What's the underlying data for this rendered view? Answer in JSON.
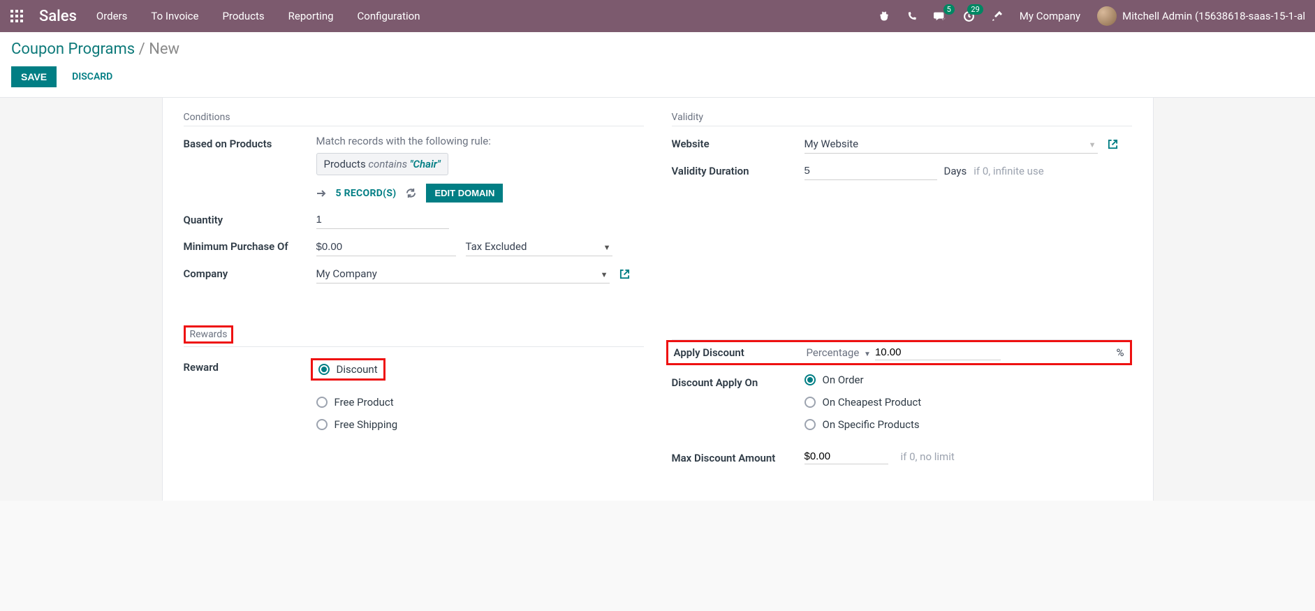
{
  "navbar": {
    "brand": "Sales",
    "menu": [
      "Orders",
      "To Invoice",
      "Products",
      "Reporting",
      "Configuration"
    ],
    "msg_badge": "5",
    "activity_badge": "29",
    "company": "My Company",
    "user": "Mitchell Admin (15638618-saas-15-1-al"
  },
  "breadcrumb": {
    "parent": "Coupon Programs",
    "current": "New"
  },
  "actions": {
    "save": "SAVE",
    "discard": "DISCARD"
  },
  "conditions": {
    "title": "Conditions",
    "based_on_products_label": "Based on Products",
    "domain_desc": "Match records with the following rule:",
    "domain_chip_field": "Products",
    "domain_chip_op": "contains",
    "domain_chip_val": "\"Chair\"",
    "records_link": "5 RECORD(S)",
    "edit_domain": "EDIT DOMAIN",
    "quantity_label": "Quantity",
    "quantity_value": "1",
    "min_purchase_label": "Minimum Purchase Of",
    "min_purchase_value": "$0.00",
    "tax_option": "Tax Excluded",
    "company_label": "Company",
    "company_value": "My Company"
  },
  "validity": {
    "title": "Validity",
    "website_label": "Website",
    "website_value": "My Website",
    "duration_label": "Validity Duration",
    "duration_value": "5",
    "days": "Days",
    "hint": "if 0, infinite use"
  },
  "rewards": {
    "title": "Rewards",
    "reward_label": "Reward",
    "options": [
      "Discount",
      "Free Product",
      "Free Shipping"
    ],
    "selected": "Discount"
  },
  "discount": {
    "apply_label": "Apply Discount",
    "type": "Percentage",
    "value": "10.00",
    "pct": "%",
    "apply_on_label": "Discount Apply On",
    "apply_on_options": [
      "On Order",
      "On Cheapest Product",
      "On Specific Products"
    ],
    "apply_on_selected": "On Order",
    "max_label": "Max Discount Amount",
    "max_value": "$0.00",
    "max_hint": "if 0, no limit"
  }
}
